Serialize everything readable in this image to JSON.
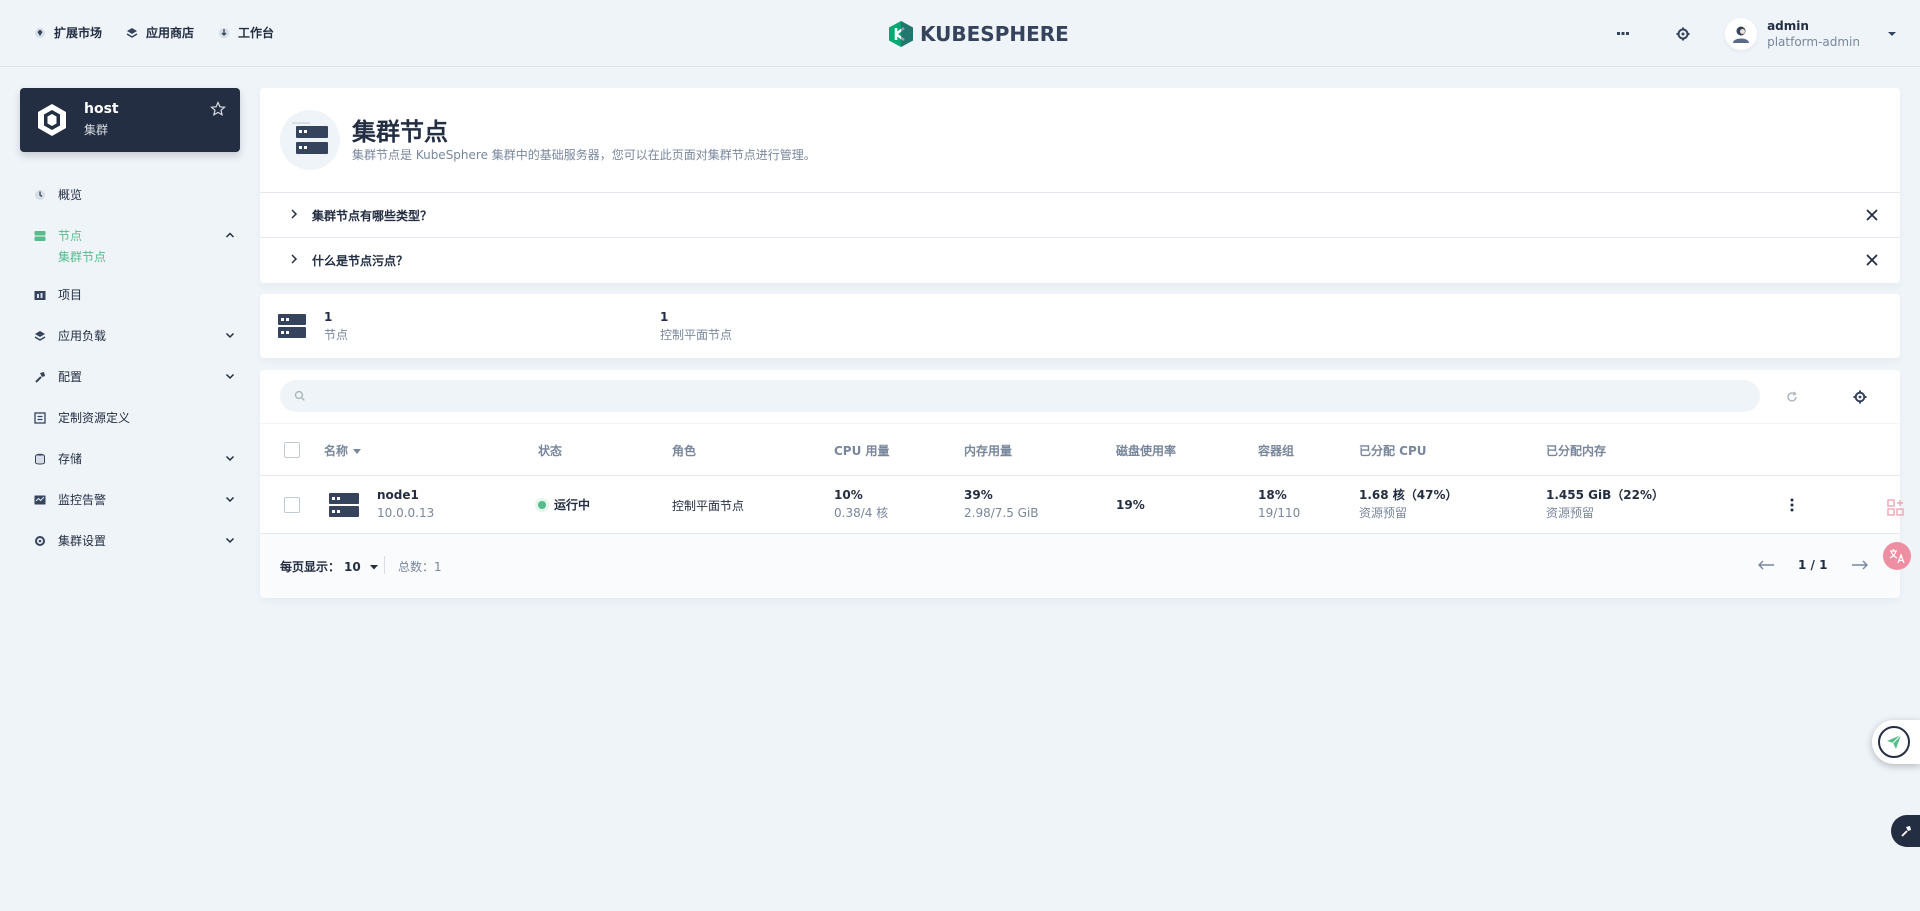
{
  "topnav": {
    "items": [
      {
        "label": "扩展市场",
        "icon": "extension-market-icon"
      },
      {
        "label": "应用商店",
        "icon": "app-store-icon"
      },
      {
        "label": "工作台",
        "icon": "workbench-icon"
      }
    ]
  },
  "logo": {
    "text": "KUBESPHERE",
    "color": "#00a971"
  },
  "user": {
    "name": "admin",
    "role": "platform-admin"
  },
  "cluster": {
    "name": "host",
    "type": "集群"
  },
  "sidebar": {
    "items": [
      {
        "label": "概览",
        "icon": "overview-icon"
      },
      {
        "label": "节点",
        "icon": "nodes-icon",
        "active": true,
        "expanded": true,
        "children": [
          {
            "label": "集群节点"
          }
        ]
      },
      {
        "label": "项目",
        "icon": "project-icon"
      },
      {
        "label": "应用负载",
        "icon": "app-workload-icon"
      },
      {
        "label": "配置",
        "icon": "config-icon"
      },
      {
        "label": "定制资源定义",
        "icon": "crd-icon"
      },
      {
        "label": "存储",
        "icon": "storage-icon"
      },
      {
        "label": "监控告警",
        "icon": "monitoring-icon"
      },
      {
        "label": "集群设置",
        "icon": "cluster-settings-icon"
      }
    ]
  },
  "page": {
    "title": "集群节点",
    "description": "集群节点是 KubeSphere 集群中的基础服务器，您可以在此页面对集群节点进行管理。"
  },
  "tips": [
    {
      "label": "集群节点有哪些类型？"
    },
    {
      "label": "什么是节点污点？"
    }
  ],
  "stats": [
    {
      "value": "1",
      "label": "节点"
    },
    {
      "value": "1",
      "label": "控制平面节点"
    }
  ],
  "search": {
    "placeholder": ""
  },
  "table": {
    "columns": [
      "名称",
      "状态",
      "角色",
      "CPU 用量",
      "内存用量",
      "磁盘使用率",
      "容器组",
      "已分配 CPU",
      "已分配内存"
    ],
    "rows": [
      {
        "name": "node1",
        "ip": "10.0.0.13",
        "status": "运行中",
        "role": "控制平面节点",
        "cpu_percent": "10%",
        "cpu_detail": "0.38/4 核",
        "mem_percent": "39%",
        "mem_detail": "2.98/7.5 GiB",
        "disk": "19%",
        "pods_percent": "18%",
        "pods_detail": "19/110",
        "alloc_cpu": "1.68 核（47%）",
        "alloc_cpu_sub": "资源预留",
        "alloc_mem": "1.455 GiB（22%）",
        "alloc_mem_sub": "资源预留"
      }
    ]
  },
  "pagination": {
    "per_page_label": "每页显示：",
    "per_page": "10",
    "total": "总数：1",
    "page": "1 / 1"
  },
  "colors": {
    "accent": "#55bc8a",
    "dark": "#242e42",
    "muted": "#79879c"
  }
}
